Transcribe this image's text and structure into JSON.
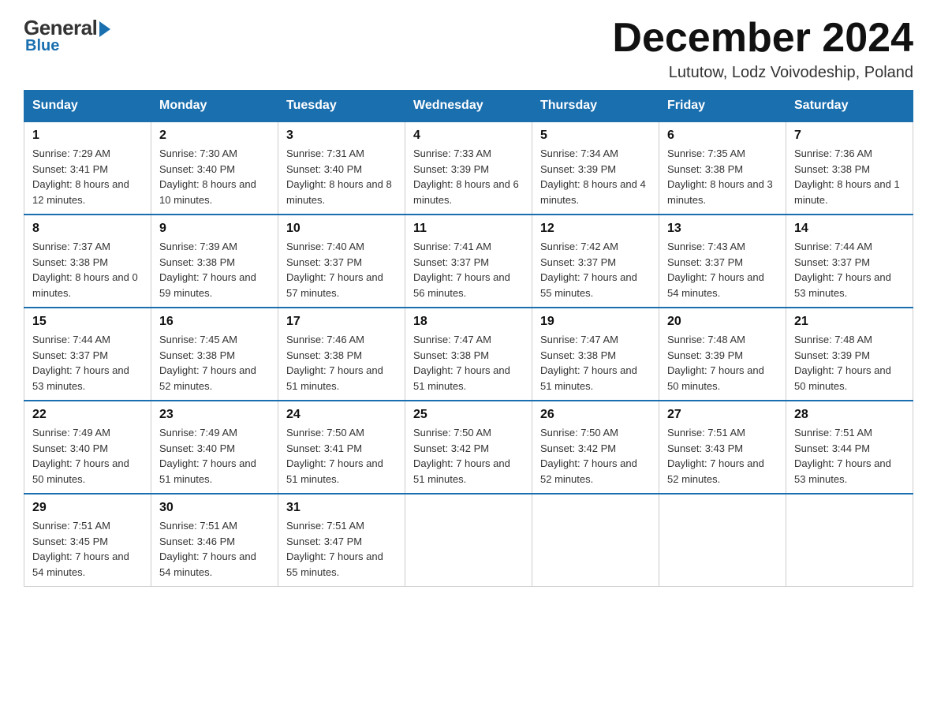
{
  "header": {
    "logo": {
      "general": "General",
      "blue": "Blue"
    },
    "title": "December 2024",
    "location": "Lututow, Lodz Voivodeship, Poland"
  },
  "days_of_week": [
    "Sunday",
    "Monday",
    "Tuesday",
    "Wednesday",
    "Thursday",
    "Friday",
    "Saturday"
  ],
  "weeks": [
    [
      {
        "day": "1",
        "sunrise": "7:29 AM",
        "sunset": "3:41 PM",
        "daylight": "8 hours and 12 minutes."
      },
      {
        "day": "2",
        "sunrise": "7:30 AM",
        "sunset": "3:40 PM",
        "daylight": "8 hours and 10 minutes."
      },
      {
        "day": "3",
        "sunrise": "7:31 AM",
        "sunset": "3:40 PM",
        "daylight": "8 hours and 8 minutes."
      },
      {
        "day": "4",
        "sunrise": "7:33 AM",
        "sunset": "3:39 PM",
        "daylight": "8 hours and 6 minutes."
      },
      {
        "day": "5",
        "sunrise": "7:34 AM",
        "sunset": "3:39 PM",
        "daylight": "8 hours and 4 minutes."
      },
      {
        "day": "6",
        "sunrise": "7:35 AM",
        "sunset": "3:38 PM",
        "daylight": "8 hours and 3 minutes."
      },
      {
        "day": "7",
        "sunrise": "7:36 AM",
        "sunset": "3:38 PM",
        "daylight": "8 hours and 1 minute."
      }
    ],
    [
      {
        "day": "8",
        "sunrise": "7:37 AM",
        "sunset": "3:38 PM",
        "daylight": "8 hours and 0 minutes."
      },
      {
        "day": "9",
        "sunrise": "7:39 AM",
        "sunset": "3:38 PM",
        "daylight": "7 hours and 59 minutes."
      },
      {
        "day": "10",
        "sunrise": "7:40 AM",
        "sunset": "3:37 PM",
        "daylight": "7 hours and 57 minutes."
      },
      {
        "day": "11",
        "sunrise": "7:41 AM",
        "sunset": "3:37 PM",
        "daylight": "7 hours and 56 minutes."
      },
      {
        "day": "12",
        "sunrise": "7:42 AM",
        "sunset": "3:37 PM",
        "daylight": "7 hours and 55 minutes."
      },
      {
        "day": "13",
        "sunrise": "7:43 AM",
        "sunset": "3:37 PM",
        "daylight": "7 hours and 54 minutes."
      },
      {
        "day": "14",
        "sunrise": "7:44 AM",
        "sunset": "3:37 PM",
        "daylight": "7 hours and 53 minutes."
      }
    ],
    [
      {
        "day": "15",
        "sunrise": "7:44 AM",
        "sunset": "3:37 PM",
        "daylight": "7 hours and 53 minutes."
      },
      {
        "day": "16",
        "sunrise": "7:45 AM",
        "sunset": "3:38 PM",
        "daylight": "7 hours and 52 minutes."
      },
      {
        "day": "17",
        "sunrise": "7:46 AM",
        "sunset": "3:38 PM",
        "daylight": "7 hours and 51 minutes."
      },
      {
        "day": "18",
        "sunrise": "7:47 AM",
        "sunset": "3:38 PM",
        "daylight": "7 hours and 51 minutes."
      },
      {
        "day": "19",
        "sunrise": "7:47 AM",
        "sunset": "3:38 PM",
        "daylight": "7 hours and 51 minutes."
      },
      {
        "day": "20",
        "sunrise": "7:48 AM",
        "sunset": "3:39 PM",
        "daylight": "7 hours and 50 minutes."
      },
      {
        "day": "21",
        "sunrise": "7:48 AM",
        "sunset": "3:39 PM",
        "daylight": "7 hours and 50 minutes."
      }
    ],
    [
      {
        "day": "22",
        "sunrise": "7:49 AM",
        "sunset": "3:40 PM",
        "daylight": "7 hours and 50 minutes."
      },
      {
        "day": "23",
        "sunrise": "7:49 AM",
        "sunset": "3:40 PM",
        "daylight": "7 hours and 51 minutes."
      },
      {
        "day": "24",
        "sunrise": "7:50 AM",
        "sunset": "3:41 PM",
        "daylight": "7 hours and 51 minutes."
      },
      {
        "day": "25",
        "sunrise": "7:50 AM",
        "sunset": "3:42 PM",
        "daylight": "7 hours and 51 minutes."
      },
      {
        "day": "26",
        "sunrise": "7:50 AM",
        "sunset": "3:42 PM",
        "daylight": "7 hours and 52 minutes."
      },
      {
        "day": "27",
        "sunrise": "7:51 AM",
        "sunset": "3:43 PM",
        "daylight": "7 hours and 52 minutes."
      },
      {
        "day": "28",
        "sunrise": "7:51 AM",
        "sunset": "3:44 PM",
        "daylight": "7 hours and 53 minutes."
      }
    ],
    [
      {
        "day": "29",
        "sunrise": "7:51 AM",
        "sunset": "3:45 PM",
        "daylight": "7 hours and 54 minutes."
      },
      {
        "day": "30",
        "sunrise": "7:51 AM",
        "sunset": "3:46 PM",
        "daylight": "7 hours and 54 minutes."
      },
      {
        "day": "31",
        "sunrise": "7:51 AM",
        "sunset": "3:47 PM",
        "daylight": "7 hours and 55 minutes."
      },
      null,
      null,
      null,
      null
    ]
  ]
}
